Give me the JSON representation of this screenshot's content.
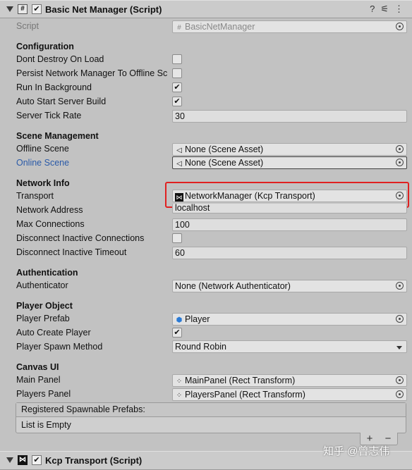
{
  "component": {
    "title": "Basic Net Manager (Script)",
    "icon": "#",
    "checked": "✔",
    "help_icon": "?",
    "settings_icon": "⚟",
    "menu_icon": "⋮"
  },
  "script": {
    "label": "Script",
    "value": "BasicNetManager"
  },
  "configuration": {
    "title": "Configuration",
    "dont_destroy": {
      "label": "Dont Destroy On Load",
      "checked": ""
    },
    "persist": {
      "label": "Persist Network Manager To Offline Sc",
      "checked": ""
    },
    "run_bg": {
      "label": "Run In Background",
      "checked": "✔"
    },
    "auto_start": {
      "label": "Auto Start Server Build",
      "checked": "✔"
    },
    "tick_rate": {
      "label": "Server Tick Rate",
      "value": "30"
    }
  },
  "scene": {
    "title": "Scene Management",
    "offline": {
      "label": "Offline Scene",
      "value": "None (Scene Asset)"
    },
    "online": {
      "label": "Online Scene",
      "value": "None (Scene Asset)"
    }
  },
  "network": {
    "title": "Network Info",
    "transport": {
      "label": "Transport",
      "value": "NetworkManager (Kcp Transport)"
    },
    "address": {
      "label": "Network Address",
      "value": "localhost"
    },
    "max_conn": {
      "label": "Max Connections",
      "value": "100"
    },
    "disconnect_inactive": {
      "label": "Disconnect Inactive Connections",
      "checked": ""
    },
    "disconnect_timeout": {
      "label": "Disconnect Inactive Timeout",
      "value": "60"
    }
  },
  "auth": {
    "title": "Authentication",
    "authenticator": {
      "label": "Authenticator",
      "value": "None (Network Authenticator)"
    }
  },
  "player": {
    "title": "Player Object",
    "prefab": {
      "label": "Player Prefab",
      "value": "Player"
    },
    "auto_create": {
      "label": "Auto Create Player",
      "checked": "✔"
    },
    "spawn_method": {
      "label": "Player Spawn Method",
      "value": "Round Robin"
    }
  },
  "canvas": {
    "title": "Canvas UI",
    "main_panel": {
      "label": "Main Panel",
      "value": "MainPanel (Rect Transform)"
    },
    "players_panel": {
      "label": "Players Panel",
      "value": "PlayersPanel (Rect Transform)"
    }
  },
  "spawnables": {
    "header": "Registered Spawnable Prefabs:",
    "empty": "List is Empty",
    "add": "+",
    "remove": "−"
  },
  "kcp": {
    "title": "Kcp Transport (Script)",
    "checked": "✔"
  },
  "watermark": "知乎 @曾志伟"
}
